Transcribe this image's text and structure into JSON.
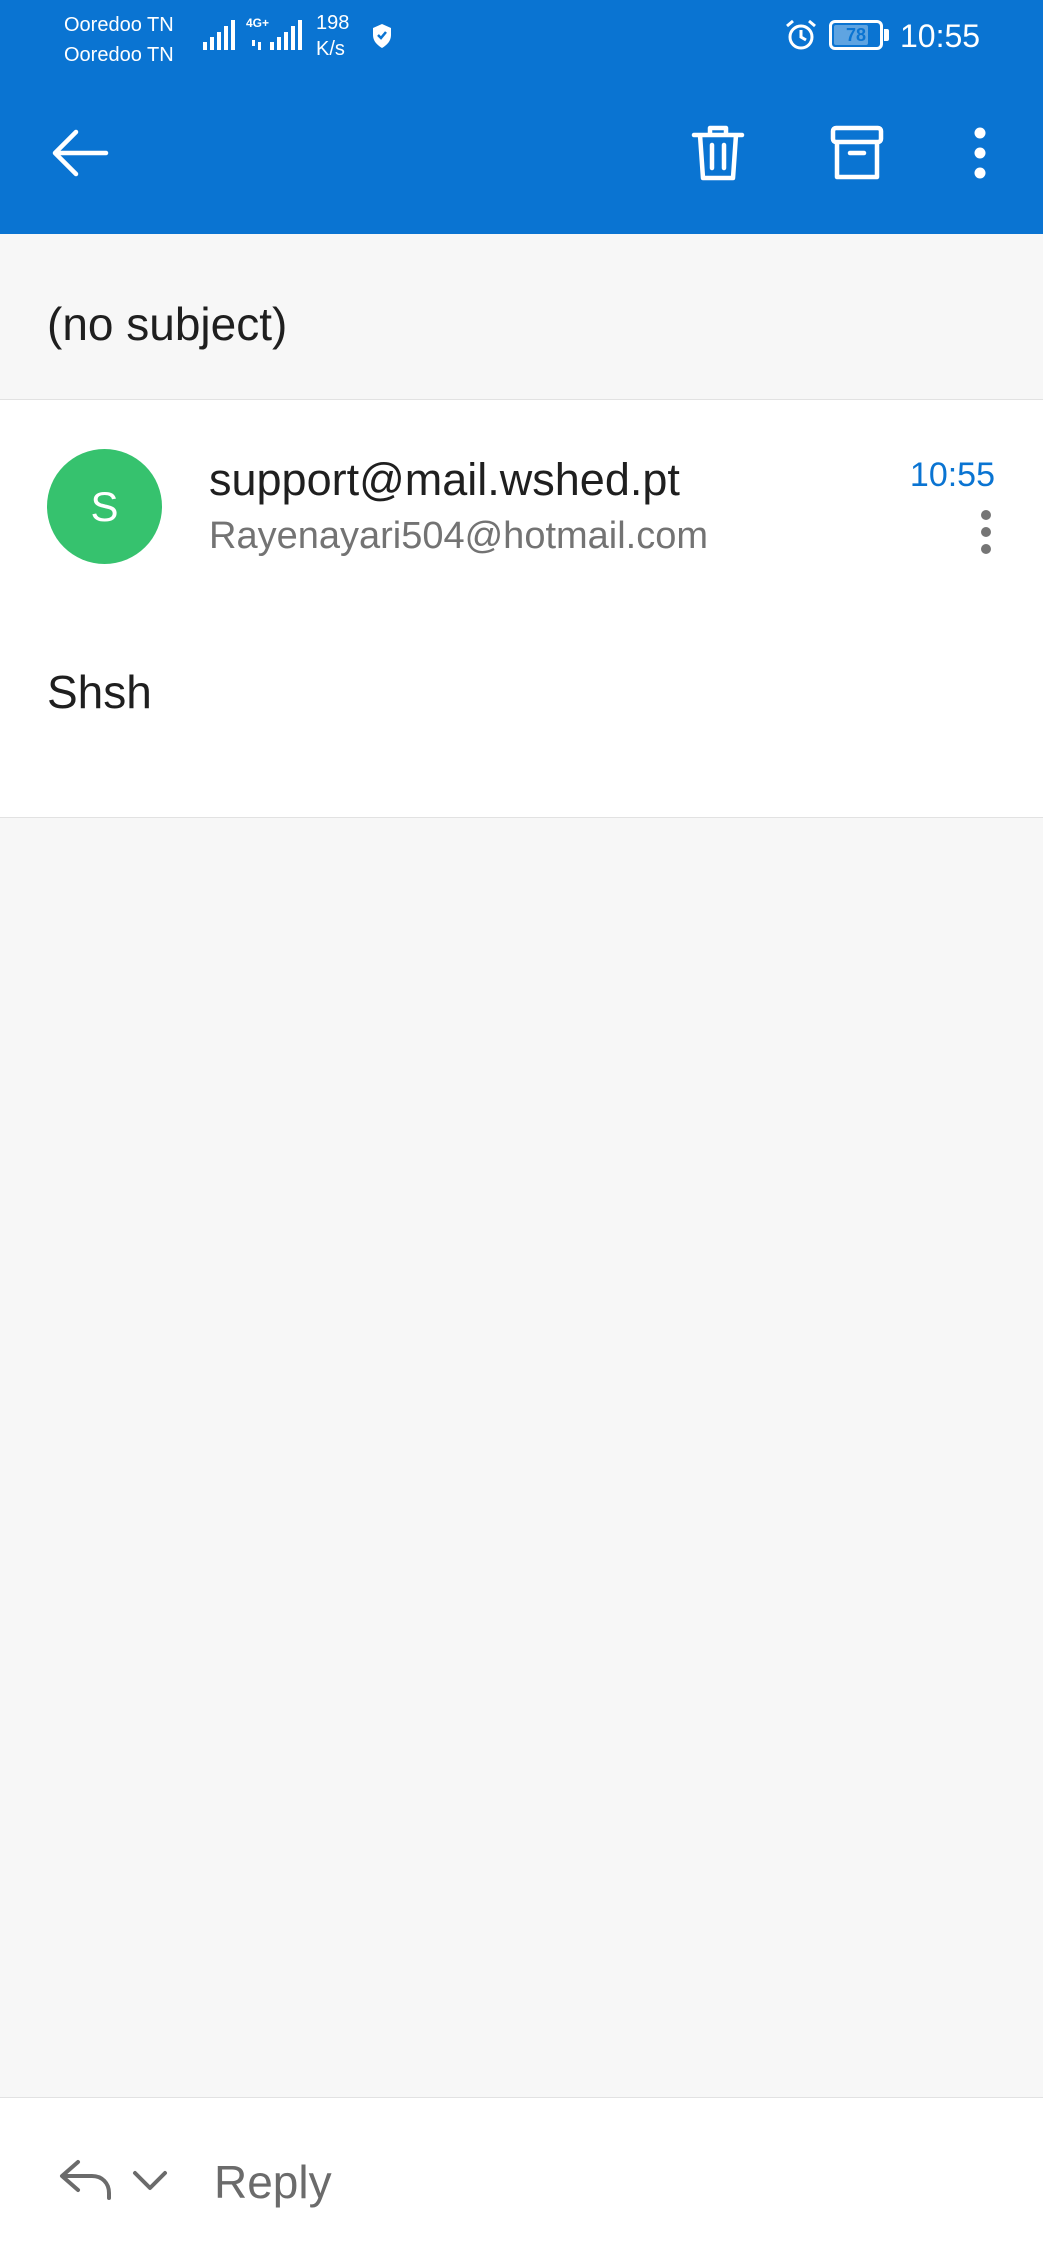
{
  "status_bar": {
    "carrier_1": "Ooredoo TN",
    "carrier_2": "Ooredoo TN",
    "network_type": "4G+",
    "speed_value": "198",
    "speed_unit": "K/s",
    "battery_level": 78,
    "battery_label": "78",
    "time": "10:55",
    "icons": [
      "signal-icon",
      "signal-icon",
      "shield-icon",
      "alarm-icon",
      "battery-icon"
    ]
  },
  "app_bar": {
    "icons": [
      "back-arrow-icon",
      "trash-icon",
      "archive-icon",
      "more-vertical-icon"
    ],
    "color": "#0a74d2"
  },
  "email": {
    "subject": "(no subject)",
    "sender": "support@mail.wshed.pt",
    "avatar_letter": "S",
    "avatar_color": "#36c26e",
    "recipient": "Rayenayari504@hotmail.com",
    "time": "10:55",
    "body": "Shsh"
  },
  "bottom_bar": {
    "reply_label": "Reply",
    "icons": [
      "reply-icon",
      "chevron-down-icon"
    ]
  }
}
